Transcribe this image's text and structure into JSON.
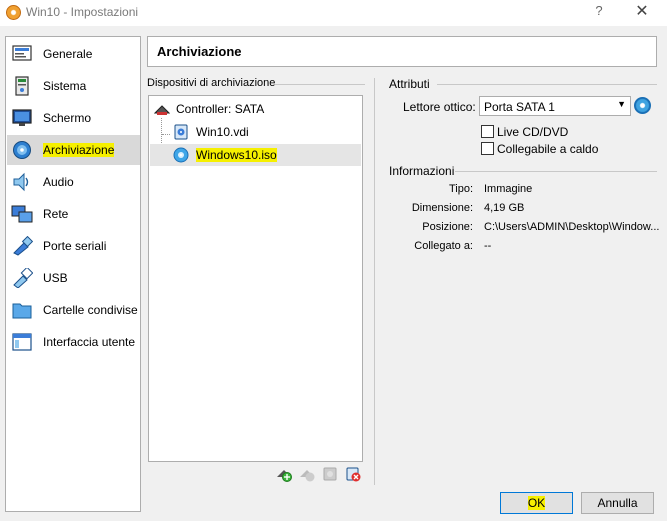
{
  "window": {
    "title": "Win10 - Impostazioni",
    "help": "?",
    "close": "✕"
  },
  "sidebar": {
    "items": [
      {
        "label": "Generale",
        "icon": "general-icon"
      },
      {
        "label": "Sistema",
        "icon": "system-icon"
      },
      {
        "label": "Schermo",
        "icon": "display-icon"
      },
      {
        "label": "Archiviazione",
        "icon": "storage-icon",
        "selected": true
      },
      {
        "label": "Audio",
        "icon": "audio-icon"
      },
      {
        "label": "Rete",
        "icon": "network-icon"
      },
      {
        "label": "Porte seriali",
        "icon": "serial-ports-icon"
      },
      {
        "label": "USB",
        "icon": "usb-icon"
      },
      {
        "label": "Cartelle condivise",
        "icon": "shared-folders-icon"
      },
      {
        "label": "Interfaccia utente",
        "icon": "user-interface-icon"
      }
    ]
  },
  "main": {
    "header": "Archiviazione",
    "devices_caption": "Dispositivi di archiviazione",
    "tree": {
      "controller": "Controller: SATA",
      "items": [
        "Win10.vdi",
        "Windows10.iso"
      ],
      "selected": "Windows10.iso"
    },
    "attributes": {
      "caption": "Attributi",
      "optical_drive_label": "Lettore ottico:",
      "optical_drive_value": "Porta SATA 1",
      "live_cd": "Live CD/DVD",
      "hot_pluggable": "Collegabile a caldo"
    },
    "info": {
      "caption": "Informazioni",
      "rows": [
        {
          "label": "Tipo:",
          "value": "Immagine"
        },
        {
          "label": "Dimensione:",
          "value": "4,19 GB"
        },
        {
          "label": "Posizione:",
          "value": "C:\\Users\\ADMIN\\Desktop\\Window..."
        },
        {
          "label": "Collegato a:",
          "value": "--"
        }
      ]
    }
  },
  "buttons": {
    "ok": "OK",
    "cancel": "Annulla"
  },
  "colors": {
    "highlight": "#f6f000",
    "selected_bg": "#d9d9d9",
    "accent": "#0078d7"
  }
}
